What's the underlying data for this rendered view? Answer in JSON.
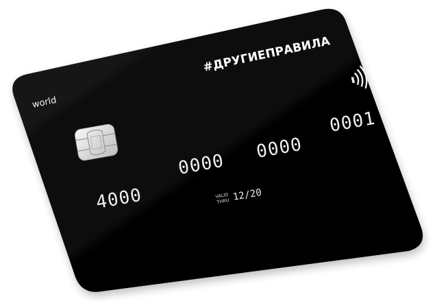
{
  "card": {
    "brand_slogan": "#ДРУГИЕПРАВИЛА",
    "network_label": "world",
    "pan_groups": [
      "4000",
      "0000",
      "0000",
      "0001"
    ],
    "valid_line1": "VALID",
    "valid_line2": "THRU",
    "expiry": "12/20",
    "body_color": "#050505",
    "text_color": "#f0f0f0",
    "chip_icon": "emv-chip-icon",
    "contactless_icon": "contactless-icon"
  }
}
